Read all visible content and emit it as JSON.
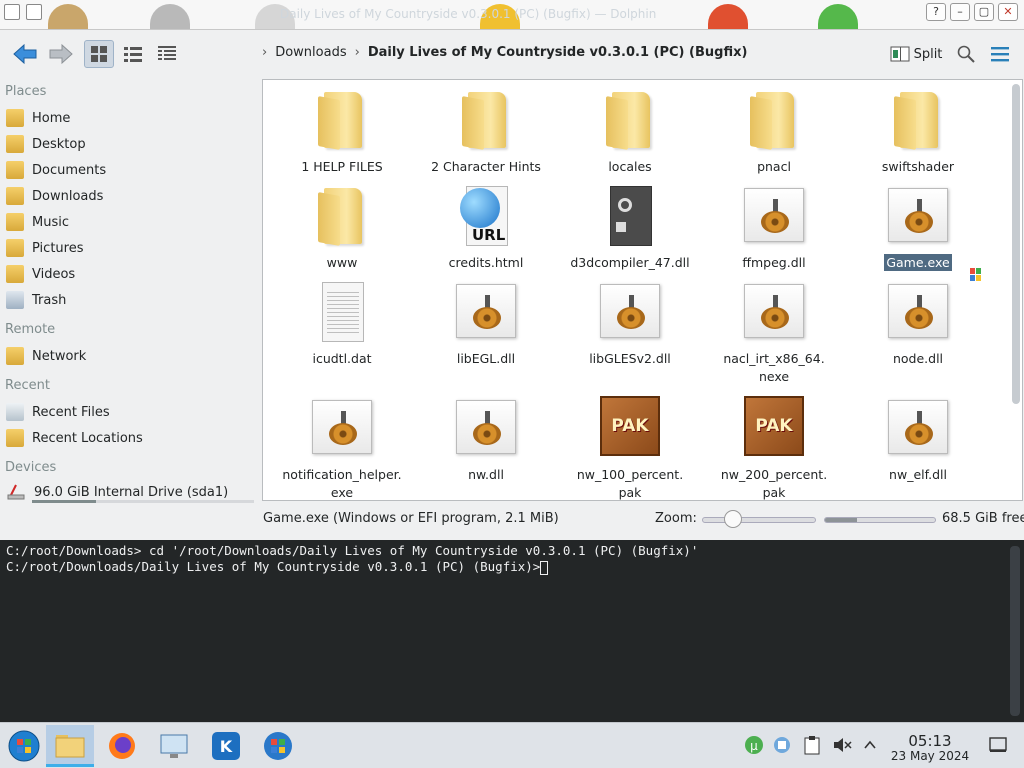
{
  "window": {
    "title": "Daily Lives of My Countryside v0.3.0.1 (PC) (Bugfix) — Dolphin"
  },
  "toolbar": {
    "split_label": "Split"
  },
  "breadcrumb": {
    "parent": "Downloads",
    "current": "Daily Lives of My Countryside v0.3.0.1 (PC) (Bugfix)"
  },
  "sidebar": {
    "places_header": "Places",
    "places": [
      {
        "label": "Home"
      },
      {
        "label": "Desktop"
      },
      {
        "label": "Documents"
      },
      {
        "label": "Downloads"
      },
      {
        "label": "Music"
      },
      {
        "label": "Pictures"
      },
      {
        "label": "Videos"
      },
      {
        "label": "Trash"
      }
    ],
    "remote_header": "Remote",
    "remote": [
      {
        "label": "Network"
      }
    ],
    "recent_header": "Recent",
    "recent": [
      {
        "label": "Recent Files"
      },
      {
        "label": "Recent Locations"
      }
    ],
    "devices_header": "Devices",
    "devices": [
      {
        "label": "96.0 GiB Internal Drive (sda1)",
        "usage_fraction": 0.29
      }
    ]
  },
  "files": [
    {
      "name": "1 HELP FILES",
      "type": "folder"
    },
    {
      "name": "2 Character Hints",
      "type": "folder"
    },
    {
      "name": "locales",
      "type": "folder"
    },
    {
      "name": "pnacl",
      "type": "folder"
    },
    {
      "name": "swiftshader",
      "type": "folder"
    },
    {
      "name": "www",
      "type": "folder"
    },
    {
      "name": "credits.html",
      "type": "url",
      "badge": "URL"
    },
    {
      "name": "d3dcompiler_47.dll",
      "type": "dll-dark"
    },
    {
      "name": "ffmpeg.dll",
      "type": "exe"
    },
    {
      "name": "Game.exe",
      "type": "exe",
      "selected": true
    },
    {
      "name": "icudtl.dat",
      "type": "data"
    },
    {
      "name": "libEGL.dll",
      "type": "exe"
    },
    {
      "name": "libGLESv2.dll",
      "type": "exe"
    },
    {
      "name": "nacl_irt_x86_64.\nnexe",
      "type": "exe"
    },
    {
      "name": "node.dll",
      "type": "exe"
    },
    {
      "name": "notification_helper.\nexe",
      "type": "exe"
    },
    {
      "name": "nw.dll",
      "type": "exe"
    },
    {
      "name": "nw_100_percent.\npak",
      "type": "pak",
      "badge": "PAK"
    },
    {
      "name": "nw_200_percent.\npak",
      "type": "pak",
      "badge": "PAK"
    },
    {
      "name": "nw_elf.dll",
      "type": "exe"
    }
  ],
  "status": {
    "selection": "Game.exe (Windows or EFI program, 2.1 MiB)",
    "zoom_label": "Zoom:",
    "zoom_fraction": 0.27,
    "free_space": "68.5 GiB free",
    "used_fraction": 0.29
  },
  "terminal": {
    "lines": [
      "C:/root/Downloads> cd '/root/Downloads/Daily Lives of My Countryside v0.3.0.1 (PC) (Bugfix)'",
      "C:/root/Downloads/Daily Lives of My Countryside v0.3.0.1 (PC) (Bugfix)>"
    ]
  },
  "taskbar": {
    "time": "05:13",
    "date": "23 May 2024"
  },
  "colors": {
    "accent": "#3daee9",
    "selection": "#4f6a82",
    "terminal_bg": "#232627"
  }
}
